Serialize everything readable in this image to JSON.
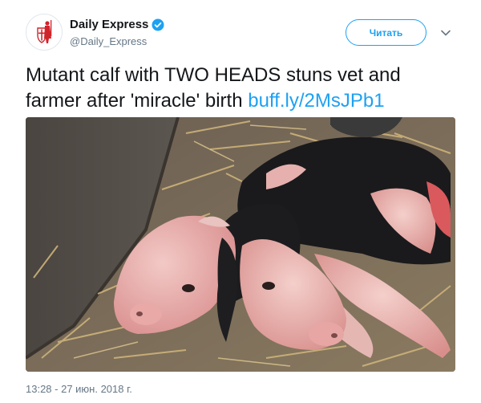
{
  "tweet": {
    "author_name": "Daily Express",
    "handle": "@Daily_Express",
    "follow_label": "Читать",
    "text": "Mutant calf with TWO HEADS stuns vet and farmer after 'miracle' birth",
    "link": "buff.ly/2MsJPb1",
    "timestamp": "13:28 - 27 июн. 2018 г."
  },
  "icons": {
    "verified": "verified-badge-icon",
    "more": "chevron-down-icon",
    "avatar": "daily-express-crusader-logo"
  },
  "colors": {
    "accent": "#1da1f2",
    "text": "#14171a",
    "secondary": "#657786",
    "logo_red": "#d0242b"
  }
}
